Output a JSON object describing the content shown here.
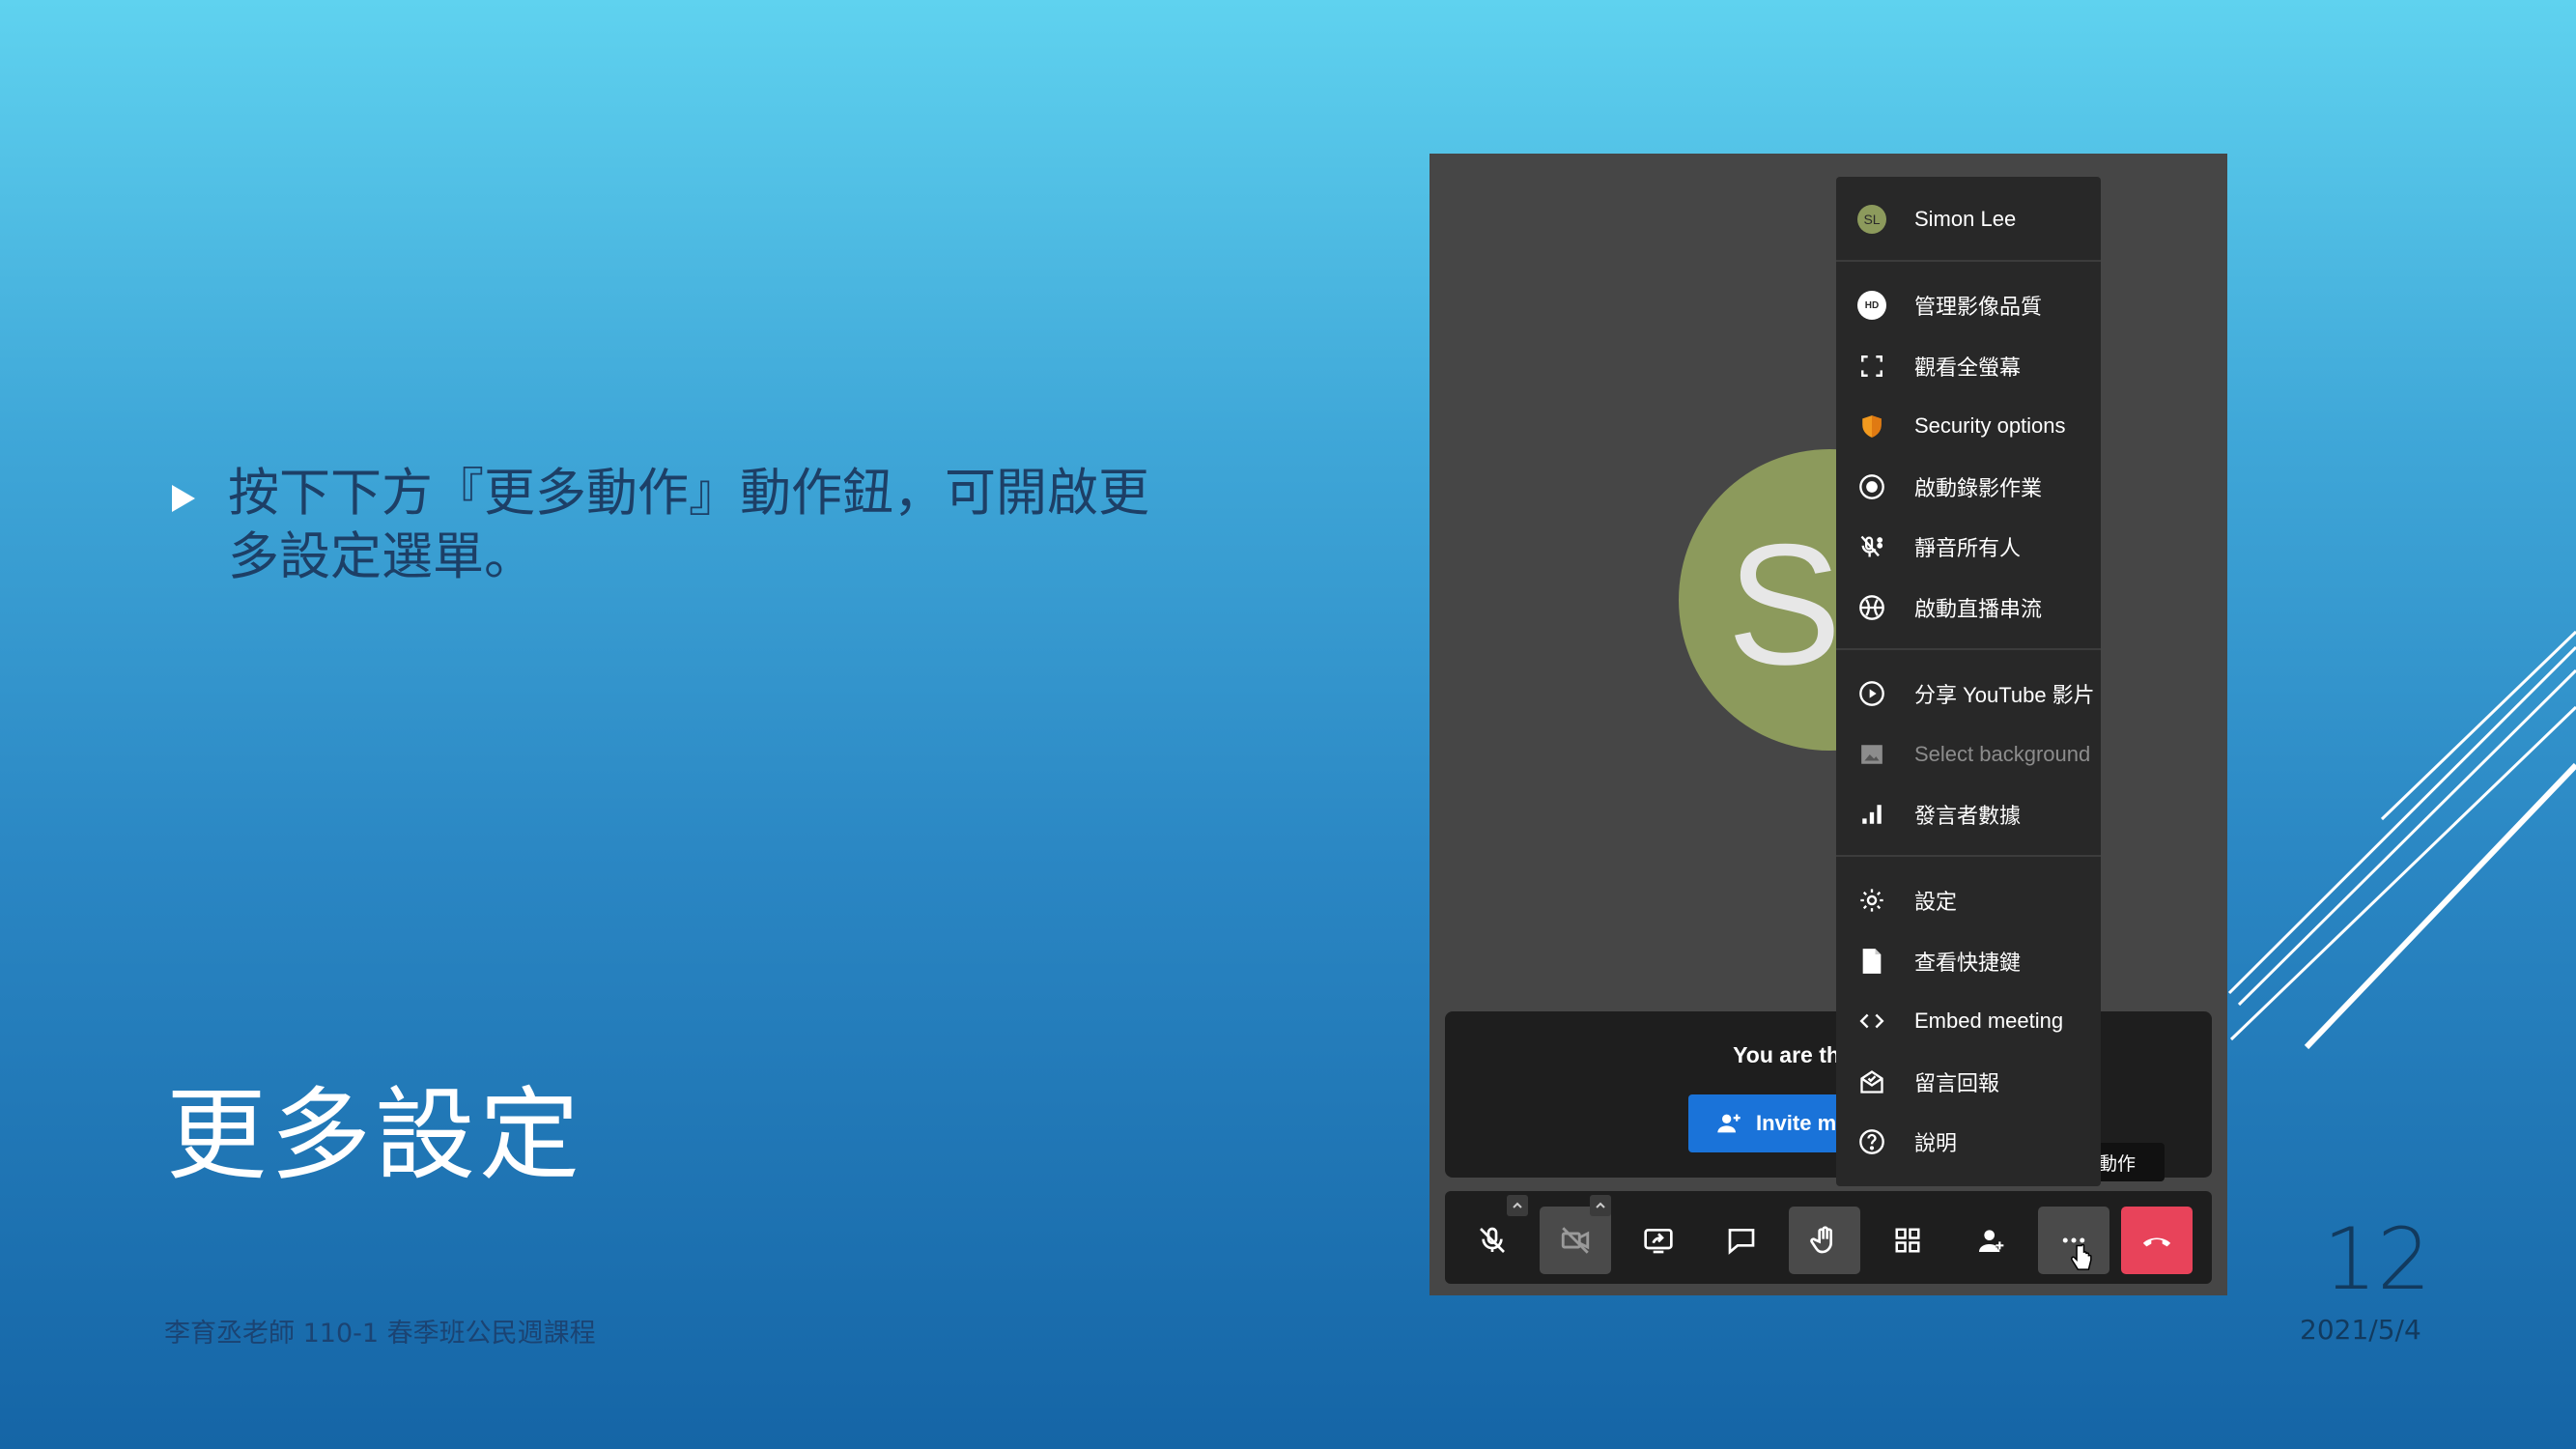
{
  "slide": {
    "bullet": "按下下方『更多動作』動作鈕，可開啟更多設定選單。",
    "title": "更多設定",
    "footer_left": "李育丞老師 110-1 春季班公民週課程",
    "page_number": "12",
    "date": "2021/5/4"
  },
  "meeting": {
    "avatar_letter": "S",
    "notice_text": "You are the only o",
    "invite_label": "Invite m",
    "tooltip": "更多動作"
  },
  "menu": {
    "user": {
      "initials": "SL",
      "name": "Simon Lee"
    },
    "items": [
      {
        "label": "管理影像品質",
        "icon": "hd-icon"
      },
      {
        "label": "觀看全螢幕",
        "icon": "fullscreen-icon"
      },
      {
        "label": "Security options",
        "icon": "shield-icon"
      },
      {
        "label": "啟動錄影作業",
        "icon": "record-icon"
      },
      {
        "label": "靜音所有人",
        "icon": "mute-all-icon"
      },
      {
        "label": "啟動直播串流",
        "icon": "livestream-icon"
      },
      {
        "label": "分享 YouTube 影片",
        "icon": "play-circle-icon"
      },
      {
        "label": "Select background",
        "icon": "background-image-icon"
      },
      {
        "label": "發言者數據",
        "icon": "bar-chart-icon"
      },
      {
        "label": "設定",
        "icon": "gear-icon"
      },
      {
        "label": "查看快捷鍵",
        "icon": "document-icon"
      },
      {
        "label": "Embed meeting",
        "icon": "code-icon"
      },
      {
        "label": "留言回報",
        "icon": "feedback-icon"
      },
      {
        "label": "說明",
        "icon": "help-icon"
      }
    ]
  },
  "colors": {
    "accent_blue": "#1a73d9",
    "hangup_red": "#e8435a",
    "avatar_olive": "#8c9a5c",
    "shield_orange": "#f29a1f"
  }
}
